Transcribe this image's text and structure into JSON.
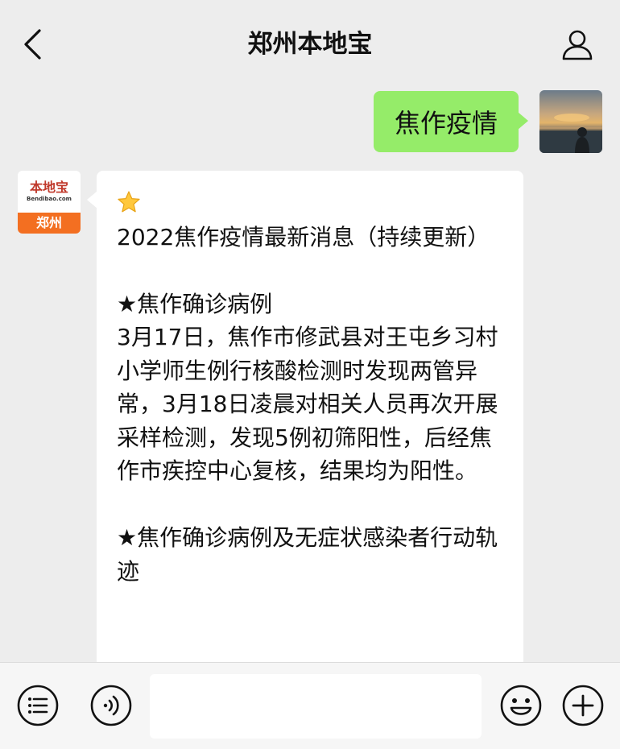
{
  "header": {
    "title": "郑州本地宝",
    "back_icon": "chevron-left-icon",
    "profile_icon": "person-icon"
  },
  "messages": {
    "outgoing": {
      "text": "焦作疫情",
      "bubble_color": "#95ec69"
    },
    "incoming": {
      "avatar": {
        "brand": "本地宝",
        "site": "Bendibao.com",
        "city": "郑州",
        "accent": "#f36f21"
      },
      "star_emoji_icon": "star-emoji-icon",
      "lines": [
        "2022焦作疫情最新消息（持续更新）",
        "",
        "★焦作确诊病例",
        "3月17日，焦作市修武县对王屯乡习村小学师生例行核酸检测时发现两管异常，3月18日凌晨对相关人员再次开展采样检测，发现5例初筛阳性，后经焦作市疾控中心复核，结果均为阳性。",
        "",
        "★焦作确诊病例及无症状感染者行动轨迹"
      ]
    }
  },
  "bottom_bar": {
    "menu_icon": "list-menu-icon",
    "voice_icon": "voice-icon",
    "input_value": "",
    "emoji_icon": "smiley-icon",
    "add_icon": "plus-icon"
  },
  "colors": {
    "background": "#ededed",
    "bubble_incoming": "#ffffff",
    "bottom_bar": "#f6f6f6"
  }
}
